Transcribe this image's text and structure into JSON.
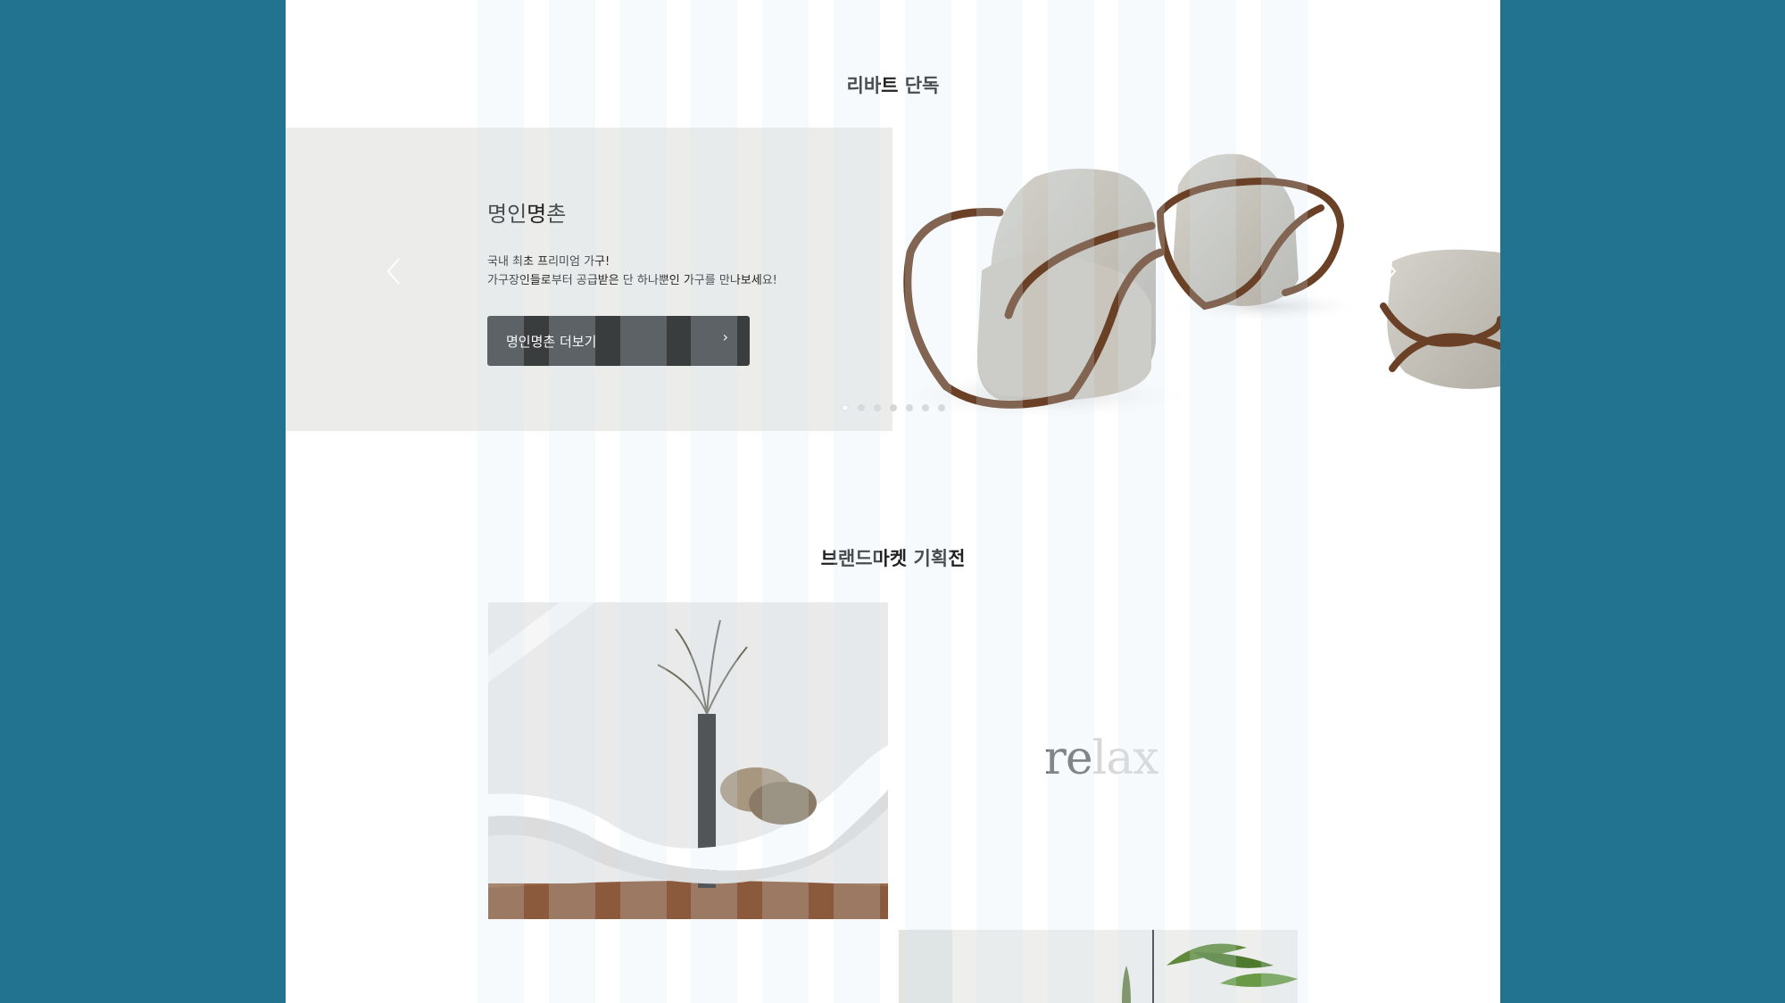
{
  "colors": {
    "background": "#21738f",
    "page": "#ffffff",
    "hero_panel": "#ececea",
    "button": "#3a3d3e"
  },
  "exclusive": {
    "title": "리바트 단독",
    "slide": {
      "title": "명인명촌",
      "desc_line1": "국내 최초 프리미엄 가구!",
      "desc_line2": "가구장인들로부터 공급받은 단 하나뿐인 가구를 만나보세요!",
      "button_label": "명인명촌 더보기"
    },
    "dots_count": 7,
    "active_dot": 1,
    "icons": {
      "prev": "chevron-left-icon",
      "next": "chevron-right-icon",
      "button": "chevron-right-icon"
    }
  },
  "brand": {
    "title": "브랜드마켓 기획전",
    "relax_dark": "re",
    "relax_light": "lax"
  }
}
